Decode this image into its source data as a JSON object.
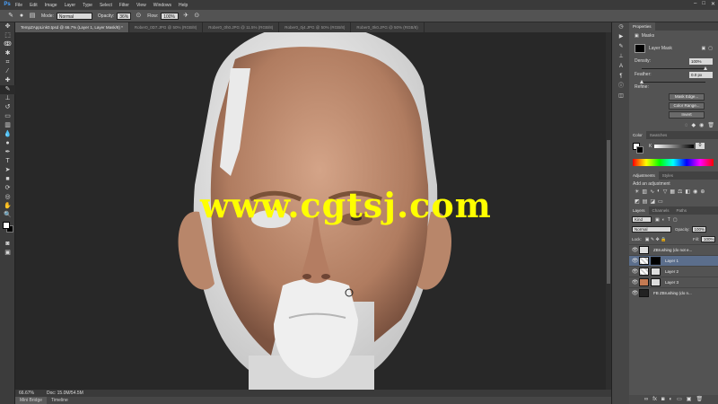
{
  "app": {
    "logo": "Ps"
  },
  "menu": [
    "File",
    "Edit",
    "Image",
    "Layer",
    "Type",
    "Select",
    "Filter",
    "View",
    "Windows",
    "Help"
  ],
  "window_controls": [
    "–",
    "□",
    "✕"
  ],
  "options_bar": {
    "mode_label": "Mode:",
    "mode_value": "Normal",
    "opacity_label": "Opacity:",
    "opacity_value": "36%",
    "flow_label": "Flow:",
    "flow_value": "100%",
    "workspace": "ezDetbat"
  },
  "tabs": [
    "TempZAppLink0.tpsd @ 66.7% (Layer 1, Layer Mask/8) *",
    "Rober0_0D7.JPG @ 50% (RGB/8)",
    "Rober0_0h0.JPG @ 11.5% (RGB/8)",
    "Rober0_0j4.JPG @ 50% (RGB/8)",
    "Rober0_0k0.JPG @ 50% (RGB/8)"
  ],
  "canvas": {
    "watermark": "www.cgtsj.com",
    "colors": {
      "background": "#282828",
      "skin": "#c99678",
      "clay": "#ececec",
      "watermark": "#ffff00"
    }
  },
  "status": {
    "zoom": "66.67%",
    "doc": "Doc: 15.0M/54.5M"
  },
  "bottom_tabs": [
    "Mini Bridge",
    "Timeline"
  ],
  "properties": {
    "tab": "Properties",
    "header": "Masks",
    "mask_type": "Layer Mask",
    "density_label": "Density:",
    "density_value": "100%",
    "feather_label": "Feather:",
    "feather_value": "0.0 px",
    "refine_label": "Refine:",
    "buttons": [
      "Mask Edge...",
      "Color Range...",
      "Invert"
    ]
  },
  "color_panel": {
    "tabs": [
      "Color",
      "Swatches"
    ],
    "k_label": "K",
    "k_value": "0",
    "k_fraction": 0.0
  },
  "adjustments": {
    "tabs": [
      "Adjustments",
      "Styles"
    ],
    "hint": "Add an adjustment"
  },
  "layers_panel": {
    "tabs": [
      "Layers",
      "Channels",
      "Paths"
    ],
    "kind": "Kind",
    "blend_mode": "Normal",
    "opacity_label": "Opacity:",
    "opacity_value": "100%",
    "lock_label": "Lock:",
    "fill_label": "Fill:",
    "fill_value": "100%",
    "layers": [
      {
        "name": "ZBrushing (do not e...",
        "selected": false
      },
      {
        "name": "Layer 1",
        "selected": true
      },
      {
        "name": "Layer 2",
        "selected": false
      },
      {
        "name": "Layer 3",
        "selected": false
      },
      {
        "name": "FB ZBrushing (do n...",
        "selected": false
      }
    ]
  }
}
